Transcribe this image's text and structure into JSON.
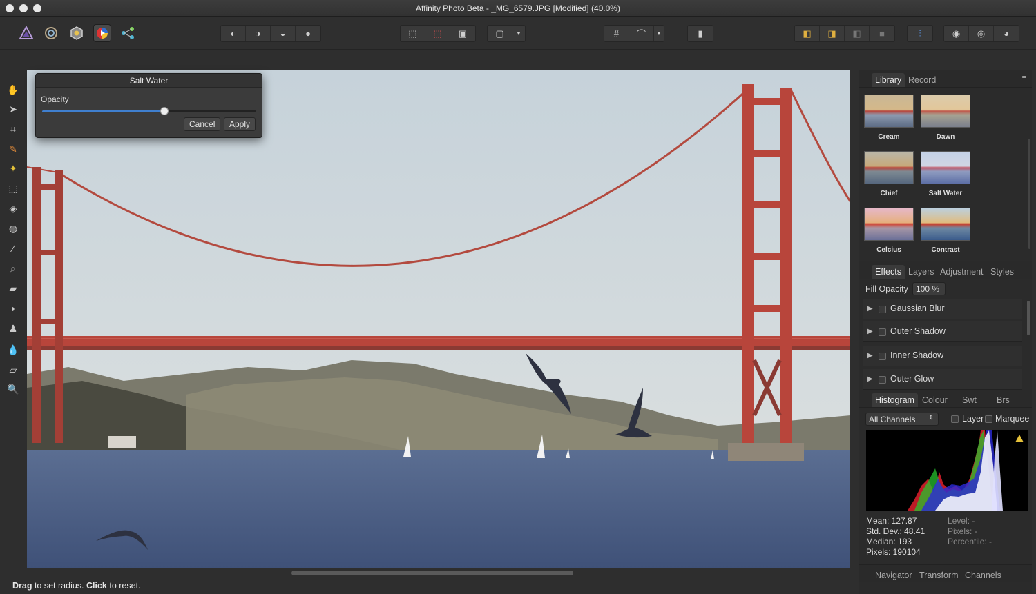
{
  "window": {
    "title": "Affinity Photo Beta - _MG_6579.JPG [Modified] (40.0%)"
  },
  "personas": [
    "photo-persona-icon",
    "liquify-persona-icon",
    "develop-persona-icon",
    "tone-mapping-persona-icon",
    "export-persona-icon"
  ],
  "dialog": {
    "title": "Salt Water",
    "opacity_label": "Opacity",
    "opacity_value": 0.57,
    "cancel_label": "Cancel",
    "apply_label": "Apply"
  },
  "library_panel": {
    "tabs": [
      "Library",
      "Record"
    ],
    "active_tab": "Library",
    "items": [
      {
        "label": "Cream"
      },
      {
        "label": "Dawn"
      },
      {
        "label": "Chief"
      },
      {
        "label": "Salt Water"
      },
      {
        "label": "Celcius"
      },
      {
        "label": "Contrast"
      }
    ]
  },
  "effects_panel": {
    "tabs": [
      "Effects",
      "Layers",
      "Adjustment",
      "Styles"
    ],
    "active_tab": "Effects",
    "fill_opacity_label": "Fill Opacity",
    "fill_opacity_value": "100 %",
    "effects": [
      {
        "label": "Gaussian Blur"
      },
      {
        "label": "Outer Shadow"
      },
      {
        "label": "Inner Shadow"
      },
      {
        "label": "Outer Glow"
      }
    ]
  },
  "histogram_panel": {
    "tabs": [
      "Histogram",
      "Colour",
      "Swt",
      "Brs"
    ],
    "active_tab": "Histogram",
    "channel_select": "All Channels",
    "layer_label": "Layer",
    "marquee_label": "Marquee",
    "stats": {
      "mean": "Mean: 127.87",
      "std_dev": "Std. Dev.: 48.41",
      "median": "Median: 193",
      "pixels": "Pixels: 190104",
      "level": "Level: -",
      "pixels_right": "Pixels: -",
      "percentile": "Percentile: -"
    }
  },
  "bottom_tabs": [
    "Navigator",
    "Transform",
    "Channels"
  ],
  "status": {
    "drag_word": "Drag",
    "drag_text": " to set radius. ",
    "click_word": "Click",
    "click_text": " to reset."
  },
  "colors": {
    "accent": "#3f7fcf",
    "bridge": "#b8453b",
    "water": "#4c5f86",
    "sky": "#c9d4dc"
  }
}
